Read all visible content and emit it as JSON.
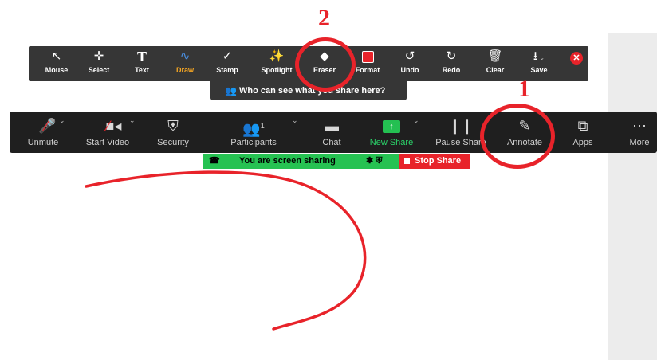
{
  "annotation_toolbar": {
    "tools": [
      {
        "key": "mouse",
        "label": "Mouse",
        "icon": "mouse-pointer-icon"
      },
      {
        "key": "select",
        "label": "Select",
        "icon": "move-arrows-icon"
      },
      {
        "key": "text",
        "label": "Text",
        "icon": "text-T-icon"
      },
      {
        "key": "draw",
        "label": "Draw",
        "icon": "squiggle-line-icon",
        "active": true
      },
      {
        "key": "stamp",
        "label": "Stamp",
        "icon": "checkmark-icon"
      },
      {
        "key": "spotlight",
        "label": "Spotlight",
        "icon": "magic-wand-icon"
      },
      {
        "key": "eraser",
        "label": "Eraser",
        "icon": "eraser-icon"
      },
      {
        "key": "format",
        "label": "Format",
        "icon": "color-swatch-icon",
        "color": "#e8232a"
      },
      {
        "key": "undo",
        "label": "Undo",
        "icon": "undo-icon"
      },
      {
        "key": "redo",
        "label": "Redo",
        "icon": "redo-icon"
      },
      {
        "key": "clear",
        "label": "Clear",
        "icon": "trash-icon"
      },
      {
        "key": "save",
        "label": "Save",
        "icon": "download-icon"
      }
    ],
    "who_can_see": "Who can see what you share here?"
  },
  "meeting_toolbar": {
    "tools": [
      {
        "key": "unmute",
        "label": "Unmute",
        "icon": "muted-mic-icon"
      },
      {
        "key": "start_video",
        "label": "Start Video",
        "icon": "video-off-icon"
      },
      {
        "key": "security",
        "label": "Security",
        "icon": "shield-icon"
      },
      {
        "key": "participants",
        "label": "Participants",
        "icon": "participants-icon",
        "count": "1"
      },
      {
        "key": "chat",
        "label": "Chat",
        "icon": "chat-bubble-icon"
      },
      {
        "key": "new_share",
        "label": "New Share",
        "icon": "share-arrow-icon"
      },
      {
        "key": "pause_share",
        "label": "Pause Share",
        "icon": "pause-icon"
      },
      {
        "key": "annotate",
        "label": "Annotate",
        "icon": "pencil-icon"
      },
      {
        "key": "apps",
        "label": "Apps",
        "icon": "apps-icon"
      },
      {
        "key": "more",
        "label": "More",
        "icon": "ellipsis-icon"
      }
    ]
  },
  "share_status": {
    "text": "You are screen sharing",
    "stop_label": "Stop Share"
  },
  "callouts": {
    "one": "1",
    "two": "2"
  },
  "colors": {
    "accent_red": "#e8232a",
    "share_green": "#26c252",
    "toolbar_dark": "#1f1f1f"
  }
}
